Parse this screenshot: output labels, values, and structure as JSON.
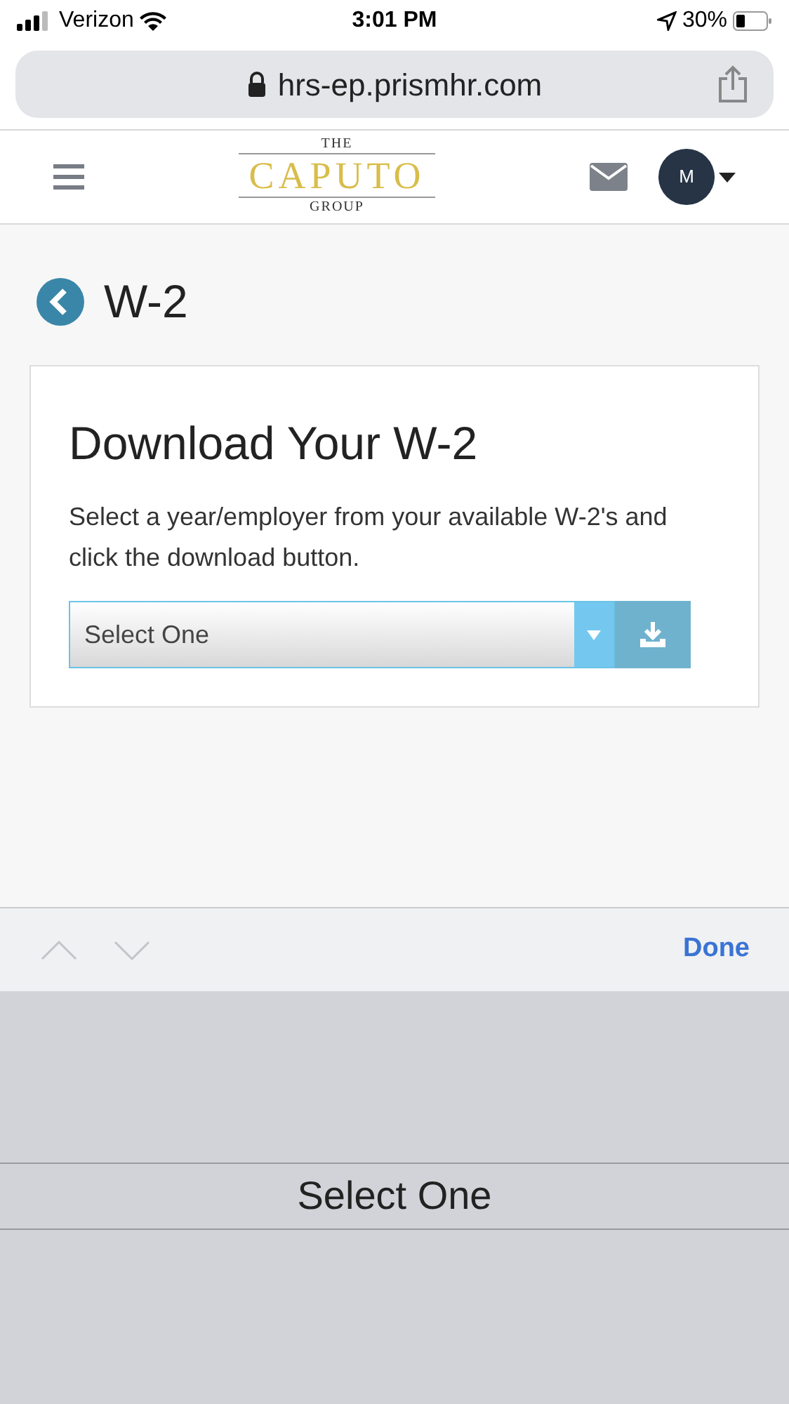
{
  "status_bar": {
    "carrier": "Verizon",
    "time": "3:01 PM",
    "battery": "30%"
  },
  "address_bar": {
    "url": "hrs-ep.prismhr.com"
  },
  "header": {
    "logo": {
      "top": "THE",
      "main": "CAPUTO",
      "bottom": "GROUP"
    },
    "avatar": "M"
  },
  "page": {
    "title": "W-2"
  },
  "card": {
    "title": "Download Your W-2",
    "description": "Select a year/employer from your available W-2's and click the download button.",
    "select": {
      "value": "Select One"
    }
  },
  "keyboard_toolbar": {
    "previous": {
      "disabled": true
    },
    "next": {
      "disabled": true
    },
    "done": "Done"
  },
  "picker": {
    "options": [
      {
        "label": "Select One",
        "selected": true
      }
    ]
  }
}
